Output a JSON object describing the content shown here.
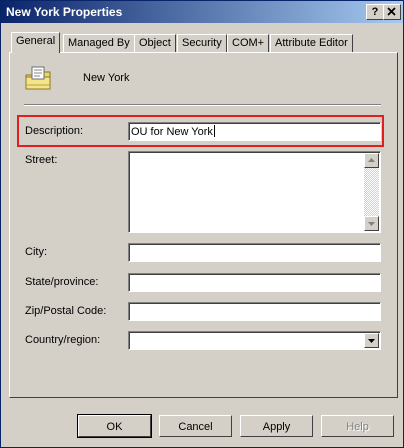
{
  "window": {
    "title": "New York Properties",
    "help_button": "?",
    "close_button": "X"
  },
  "tabs": [
    {
      "label": "General",
      "active": true
    },
    {
      "label": "Managed By"
    },
    {
      "label": "Object"
    },
    {
      "label": "Security"
    },
    {
      "label": "COM+"
    },
    {
      "label": "Attribute Editor"
    }
  ],
  "general": {
    "object_icon": "organizational-unit-icon",
    "object_name": "New York",
    "description_label": "Description:",
    "description_value": "OU for New York",
    "street_label": "Street:",
    "street_value": "",
    "city_label": "City:",
    "city_value": "",
    "state_label": "State/province:",
    "state_value": "",
    "zip_label": "Zip/Postal Code:",
    "zip_value": "",
    "country_label": "Country/region:",
    "country_value": ""
  },
  "footer": {
    "ok": "OK",
    "cancel": "Cancel",
    "apply": "Apply",
    "help": "Help"
  },
  "colors": {
    "highlight": "#e02020",
    "titlebar_start": "#0a246a",
    "titlebar_end": "#a6caf0",
    "face": "#d4d0c8"
  }
}
